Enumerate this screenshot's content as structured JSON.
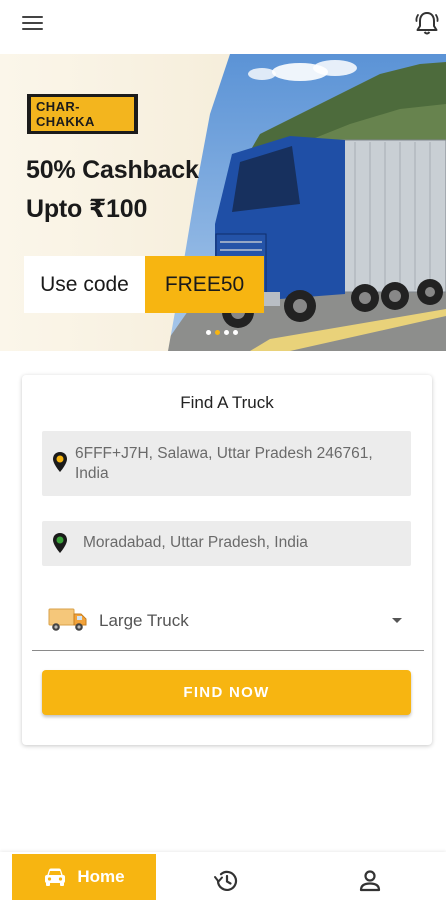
{
  "header": {
    "menu_icon": "hamburger-menu-icon",
    "notification_icon": "bell-icon"
  },
  "banner": {
    "brand": "CHAR-CHAKKA",
    "headline_line1": "50% Cashback",
    "headline_line2": "Upto ₹100",
    "code_label": "Use code",
    "code_value": "FREE50",
    "slides_total": 4,
    "active_slide": 1,
    "accent_color": "#f7b511"
  },
  "find_truck": {
    "title": "Find A Truck",
    "pickup_location": "6FFF+J7H, Salawa, Uttar Pradesh 246761, India",
    "drop_location": "Moradabad, Uttar Pradesh, India",
    "truck_type": "Large Truck",
    "submit_label": "FIND NOW"
  },
  "bottom_nav": {
    "home_label": "Home",
    "home_icon": "car-icon",
    "history_icon": "history-icon",
    "profile_icon": "profile-icon",
    "active": "Home"
  }
}
